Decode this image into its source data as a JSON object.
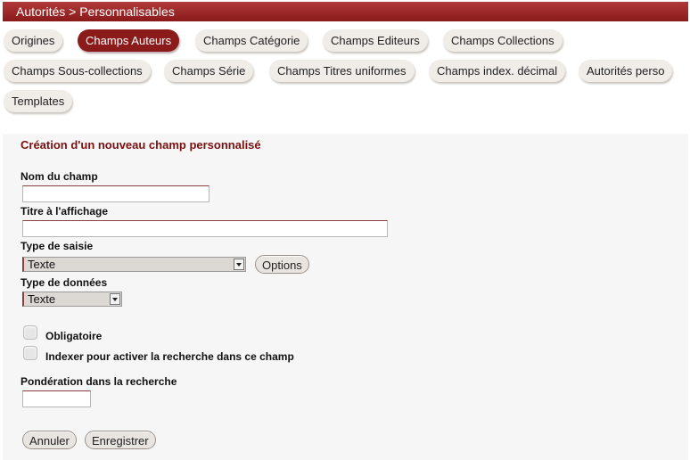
{
  "header": {
    "breadcrumb": "Autorités > Personnalisables"
  },
  "tabs": [
    {
      "label": "Origines"
    },
    {
      "label": "Champs Auteurs"
    },
    {
      "label": "Champs Catégorie"
    },
    {
      "label": "Champs Editeurs"
    },
    {
      "label": "Champs Collections"
    },
    {
      "label": "Champs Sous-collections"
    },
    {
      "label": "Champs Série"
    },
    {
      "label": "Champs Titres uniformes"
    },
    {
      "label": "Champs index. décimal"
    },
    {
      "label": "Autorités perso"
    },
    {
      "label": "Templates"
    }
  ],
  "form": {
    "title": "Création d'un nouveau champ personnalisé",
    "field_name_label": "Nom du champ",
    "field_name_value": "",
    "display_title_label": "Titre à l'affichage",
    "display_title_value": "",
    "input_type_label": "Type de saisie",
    "input_type_value": "Texte",
    "options_button": "Options",
    "data_type_label": "Type de données",
    "data_type_value": "Texte",
    "mandatory_label": "Obligatoire",
    "index_label": "Indexer pour activer la recherche dans ce champ",
    "weighting_label": "Pondération dans la recherche",
    "weighting_value": "",
    "cancel_button": "Annuler",
    "save_button": "Enregistrer"
  },
  "colors": {
    "accent": "#8b1a1a",
    "header": "#a03030",
    "title": "#7a1010"
  }
}
